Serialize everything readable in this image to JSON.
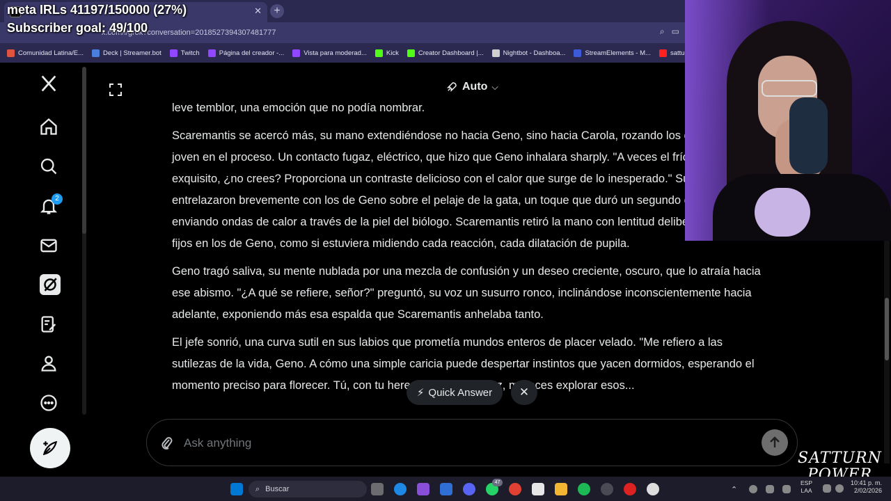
{
  "overlay": {
    "meta_line": "meta IRLs 41197/150000 (27%)",
    "subscriber_goal": "Subscriber goal: 49/100"
  },
  "browser": {
    "url": "x.com/i/grok?conversation=2018527394307481777",
    "bookmarks": [
      {
        "label": "Comunidad Latina/E...",
        "color": "#e0533f"
      },
      {
        "label": "Deck | Streamer.bot",
        "color": "#4a7fe0"
      },
      {
        "label": "Twitch",
        "color": "#9146ff"
      },
      {
        "label": "Página del creador -...",
        "color": "#9146ff"
      },
      {
        "label": "Vista para moderad...",
        "color": "#9146ff"
      },
      {
        "label": "Kick",
        "color": "#53fc18"
      },
      {
        "label": "Creator Dashboard |...",
        "color": "#53fc18"
      },
      {
        "label": "Nightbot - Dashboa...",
        "color": "#cfcfcf"
      },
      {
        "label": "StreamElements - M...",
        "color": "#3b5bdb"
      },
      {
        "label": "satturn...",
        "color": "#ff2020"
      }
    ]
  },
  "sidebar": {
    "notifications_count": "2"
  },
  "grok": {
    "mode_label": "Auto",
    "paragraphs": [
      "leve temblor, una emoción que no podía nombrar.",
      "Scaremantis se acercó más, su mano extendiéndose no hacia Geno, sino hacia Carola, rozando los dedos del joven en el proceso. Un contacto fugaz, eléctrico, que hizo que Geno inhalara sharply. \"A veces el frío puede ser exquisito, ¿no crees? Proporciona un contraste delicioso con el calor que surge de lo inesperado.\" Sus dedos se entrelazaron brevemente con los de Geno sobre el pelaje de la gata, un toque que duró un segundo de más, enviando ondas de calor a través de la piel del biólogo. Scaremantis retiró la mano con lentitud deliberada, sus ojos fijos en los de Geno, como si estuviera midiendo cada reacción, cada dilatación de pupila.",
      "Geno tragó saliva, su mente nublada por una mezcla de confusión y un deseo creciente, oscuro, que lo atraía hacia ese abismo. \"¿A qué se refiere, señor?\" preguntó, su voz un susurro ronco, inclinándose inconscientemente hacia adelante, exponiendo más esa espalda que Scaremantis anhelaba tanto.",
      "El jefe sonrió, una curva sutil en sus labios que prometía mundos enteros de placer velado. \"Me refiero a las sutilezas de la vida, Geno. A cómo una simple caricia puede despertar instintos que yacen dormidos, esperando el momento preciso para florecer. Tú, con tu herencia y tu brillantez, mereces explorar esos..."
    ],
    "quick_answer_label": "Quick Answer",
    "ask_placeholder": "Ask anything"
  },
  "logo": {
    "line1": "SATTURN",
    "line2": "POWER"
  },
  "taskbar": {
    "search_label": "Buscar",
    "whatsapp_badge": "47",
    "lang_line1": "ESP",
    "lang_line2": "LAA",
    "time": "10:41 p. m.",
    "date": "2/02/2026"
  }
}
